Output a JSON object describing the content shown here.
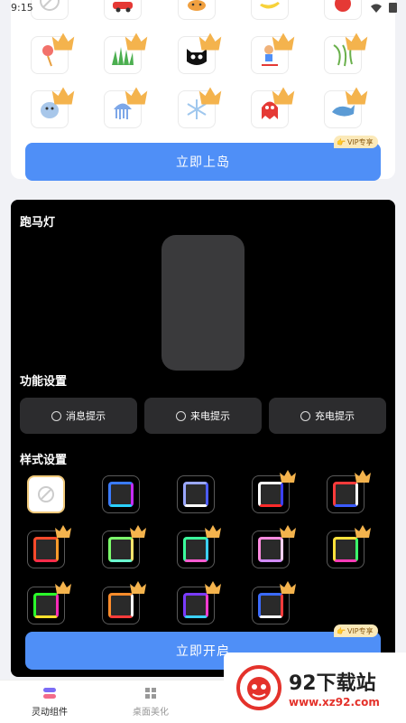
{
  "status_bar": {
    "time": "9:15"
  },
  "top_section": {
    "stickers": [
      {
        "icon": "no-sticker-icon"
      },
      {
        "icon": "car-icon"
      },
      {
        "icon": "fox-icon"
      },
      {
        "icon": "banana-icon"
      },
      {
        "icon": "apple-icon"
      },
      {
        "icon": "lantern-icon"
      },
      {
        "icon": "grass-icon"
      },
      {
        "icon": "cat-icon"
      },
      {
        "icon": "scooter-girl-icon"
      },
      {
        "icon": "willow-icon"
      },
      {
        "icon": "sloth-icon"
      },
      {
        "icon": "jellyfish-icon"
      },
      {
        "icon": "snowflake-icon"
      },
      {
        "icon": "ghost-icon"
      },
      {
        "icon": "whale-icon"
      }
    ],
    "button_label": "立即上岛",
    "vip_label": "VIP专享"
  },
  "marquee": {
    "title": "跑马灯",
    "function_title": "功能设置",
    "functions": [
      {
        "label": "消息提示"
      },
      {
        "label": "来电提示"
      },
      {
        "label": "充电提示"
      }
    ],
    "style_title": "样式设置",
    "styles": [
      {
        "icon": "none-style-icon",
        "selected": true
      },
      {
        "colors": [
          "#3a7bff",
          "#c62bff",
          "#2bd1ff"
        ]
      },
      {
        "colors": [
          "#9aa7ff",
          "#4c5cff",
          "#ffffff"
        ]
      },
      {
        "colors": [
          "#ffffff",
          "#3b40ff",
          "#ff2b2b"
        ]
      },
      {
        "colors": [
          "#ff3b3b",
          "#ffffff",
          "#3b5bff"
        ]
      },
      {
        "colors": [
          "#ff4a2b",
          "#ff9c2b",
          "#ff2b4a"
        ]
      },
      {
        "colors": [
          "#7cff6b",
          "#ffe46b",
          "#6bffd0"
        ]
      },
      {
        "colors": [
          "#3bff9c",
          "#3bd1ff",
          "#ff5bd1"
        ]
      },
      {
        "colors": [
          "#ff8be0",
          "#ffd1f3",
          "#d18bff"
        ]
      },
      {
        "colors": [
          "#ffe13b",
          "#3bff6b",
          "#ff3bb8"
        ]
      },
      {
        "colors": [
          "#2bff2b",
          "#ff2bb8",
          "#ffe02b"
        ]
      },
      {
        "colors": [
          "#ff8c2b",
          "#ffffff",
          "#ff3b3b"
        ]
      },
      {
        "colors": [
          "#7a3bff",
          "#ff3bd1",
          "#3bd1ff"
        ]
      },
      {
        "colors": [
          "#3b6bff",
          "#ff3b3b",
          "#ffffff"
        ]
      }
    ],
    "button_label": "立即开启",
    "vip_label": "VIP专享"
  },
  "bottom_nav": [
    {
      "label": "灵动组件",
      "active": true
    },
    {
      "label": "桌面美化",
      "active": false
    }
  ],
  "watermark": {
    "title": "92下载站",
    "url": "www.xz92.com"
  },
  "colors": {
    "accent": "#4f8ff7",
    "vip_bg": "#fbe9b9",
    "crown": "#f4b34d"
  }
}
